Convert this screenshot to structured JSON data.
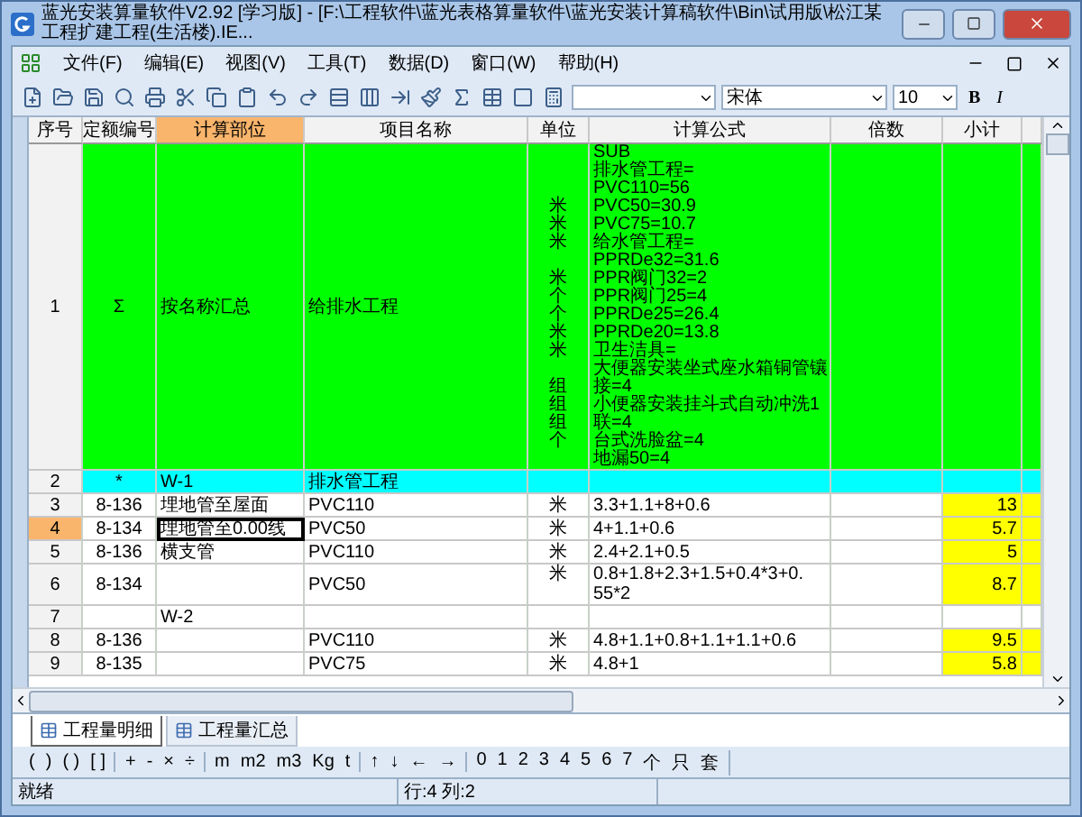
{
  "window": {
    "title": "蓝光安装算量软件V2.92 [学习版] - [F:\\工程软件\\蓝光表格算量软件\\蓝光安装计算稿软件\\Bin\\试用版\\松江某工程扩建工程(生活楼).IE..."
  },
  "menu": [
    "文件(F)",
    "编辑(E)",
    "视图(V)",
    "工具(T)",
    "数据(D)",
    "窗口(W)",
    "帮助(H)"
  ],
  "toolbar": {
    "font": "宋体",
    "size": "10",
    "bold": "B",
    "italic": "I"
  },
  "columns": [
    {
      "label": "序号",
      "selected": false
    },
    {
      "label": "定额编号",
      "selected": false
    },
    {
      "label": "计算部位",
      "selected": true
    },
    {
      "label": "项目名称",
      "selected": false
    },
    {
      "label": "单位",
      "selected": false
    },
    {
      "label": "计算公式",
      "selected": false
    },
    {
      "label": "倍数",
      "selected": false
    },
    {
      "label": "小计",
      "selected": false
    }
  ],
  "rows": [
    {
      "kind": "summary",
      "seq": "1",
      "code": "Σ",
      "part": "按名称汇总",
      "name": "给排水工程",
      "lines": [
        {
          "formula": "SUB"
        },
        {
          "formula": "排水管工程="
        },
        {
          "formula": "PVC110=56"
        },
        {
          "formula": "PVC50=30.9",
          "unit": "米"
        },
        {
          "formula": "PVC75=10.7",
          "unit": "米"
        },
        {
          "formula": "给水管工程=",
          "unit": "米"
        },
        {
          "formula": "PPRDe32=31.6"
        },
        {
          "formula": "PPR阀门32=2",
          "unit": "米"
        },
        {
          "formula": "PPR阀门25=4",
          "unit": "个"
        },
        {
          "formula": "PPRDe25=26.4",
          "unit": "个"
        },
        {
          "formula": "PPRDe20=13.8",
          "unit": "米"
        },
        {
          "formula": "卫生洁具=",
          "unit": "米"
        },
        {
          "formula": "大便器安装坐式座水箱铜管镶"
        },
        {
          "formula": "接=4",
          "unit": "组"
        },
        {
          "formula": "小便器安装挂斗式自动冲洗1",
          "unit": "组"
        },
        {
          "formula": "联=4",
          "unit": "组"
        },
        {
          "formula": "台式洗脸盆=4",
          "unit": "个"
        },
        {
          "formula": "地漏50=4"
        }
      ],
      "selected": false
    },
    {
      "kind": "group",
      "seq": "2",
      "code": "*",
      "part": "W-1",
      "name": "排水管工程",
      "lines": [],
      "selected": false
    },
    {
      "kind": "item",
      "seq": "3",
      "code": "8-136",
      "part": "埋地管至屋面",
      "name": "PVC110",
      "lines": [
        {
          "formula": "3.3+1.1+8+0.6",
          "unit": "米"
        }
      ],
      "subtotal": "13",
      "selected": false
    },
    {
      "kind": "item",
      "seq": "4",
      "code": "8-134",
      "part": "埋地管至0.00线",
      "name": "PVC50",
      "lines": [
        {
          "formula": "4+1.1+0.6",
          "unit": "米"
        }
      ],
      "subtotal": "5.7",
      "selected": true
    },
    {
      "kind": "item",
      "seq": "5",
      "code": "8-136",
      "part": "横支管",
      "name": "PVC110",
      "lines": [
        {
          "formula": "2.4+2.1+0.5",
          "unit": "米"
        }
      ],
      "subtotal": "5",
      "selected": false
    },
    {
      "kind": "item",
      "seq": "6",
      "code": "8-134",
      "name": "PVC50",
      "lines": [
        {
          "formula": "0.8+1.8+2.3+1.5+0.4*3+0.",
          "unit": "米"
        },
        {
          "formula": "55*2"
        }
      ],
      "subtotal": "8.7",
      "selected": false
    },
    {
      "kind": "item",
      "seq": "7",
      "part": "W-2",
      "lines": [],
      "selected": false
    },
    {
      "kind": "item",
      "seq": "8",
      "code": "8-136",
      "name": "PVC110",
      "lines": [
        {
          "formula": "4.8+1.1+0.8+1.1+1.1+0.6",
          "unit": "米"
        }
      ],
      "subtotal": "9.5",
      "selected": false
    },
    {
      "kind": "item",
      "seq": "9",
      "code": "8-135",
      "name": "PVC75",
      "lines": [
        {
          "formula": "4.8+1",
          "unit": "米"
        }
      ],
      "subtotal": "5.8",
      "selected": false
    }
  ],
  "sheet_tabs": [
    {
      "label": "工程量明细",
      "selected": true
    },
    {
      "label": "工程量汇总",
      "selected": false
    }
  ],
  "symbols": [
    [
      "(",
      ")",
      "( )",
      "[ ]"
    ],
    [
      "+",
      "-",
      "×",
      "÷"
    ],
    [
      "m",
      "m2",
      "m3",
      "Kg",
      "t"
    ],
    [
      "↑",
      "↓",
      "←",
      "→"
    ],
    [
      "0",
      "1",
      "2",
      "3",
      "4",
      "5",
      "6",
      "7",
      "个",
      "只",
      "套"
    ]
  ],
  "status_bar": {
    "message": "就绪",
    "position": "行:4 列:2"
  }
}
